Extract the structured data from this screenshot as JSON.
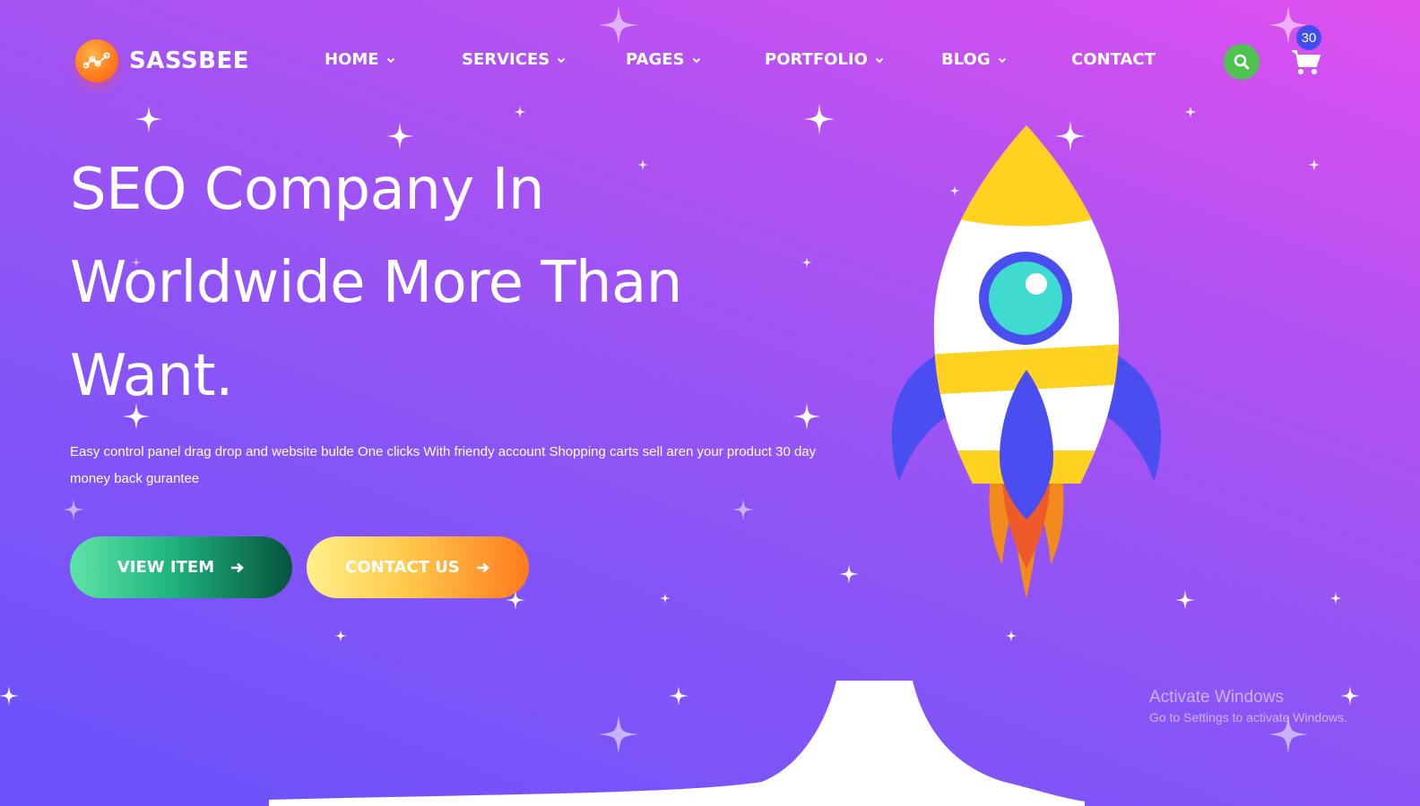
{
  "brand": {
    "name": "SASSBEE",
    "logo_icon": "chart-line-icon"
  },
  "nav": {
    "items": [
      {
        "label": "HOME",
        "has_dropdown": true
      },
      {
        "label": "SERVICES",
        "has_dropdown": true
      },
      {
        "label": "PAGES",
        "has_dropdown": true
      },
      {
        "label": "PORTFOLIO",
        "has_dropdown": true
      },
      {
        "label": "BLOG",
        "has_dropdown": true
      },
      {
        "label": "CONTACT",
        "has_dropdown": false
      }
    ]
  },
  "header_actions": {
    "search_icon": "search-icon",
    "cart_icon": "cart-icon",
    "cart_count": "30"
  },
  "hero": {
    "title_line1": "SEO Company In",
    "title_line2": "Worldwide More Than",
    "title_line3": "Want.",
    "description": "Easy control panel drag drop and website bulde One clicks With friendy account Shopping carts sell aren your product 30 day money back gurantee",
    "buttons": {
      "view_item": "VIEW ITEM",
      "contact_us": "CONTACT US"
    }
  },
  "watermark": {
    "line1": "Activate Windows",
    "line2": "Go to Settings to activate Windows."
  },
  "colors": {
    "search_button": "#4fc24f",
    "cart_badge": "#3f4ef0",
    "rocket_yellow": "#ffd21f",
    "rocket_blue": "#4a4ef0",
    "rocket_window": "#3fdbd0",
    "flame_orange": "#f28a1e",
    "flame_red": "#ef5a2a"
  }
}
